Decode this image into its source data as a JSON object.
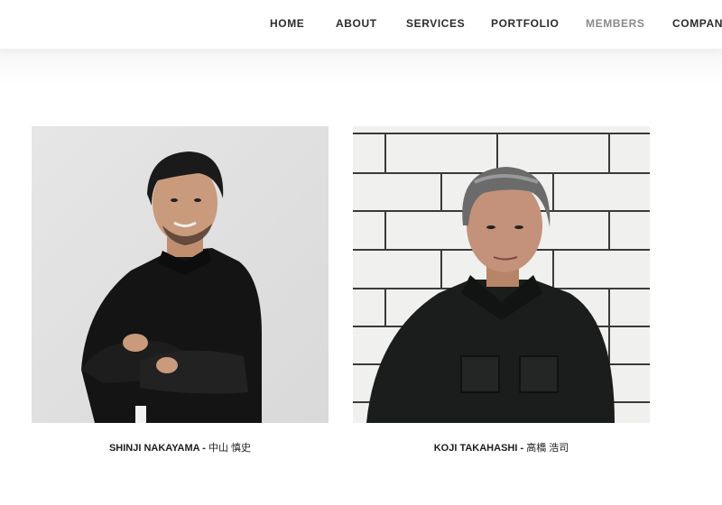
{
  "nav": {
    "items": [
      {
        "label": "HOME",
        "active": false
      },
      {
        "label": "ABOUT",
        "active": false
      },
      {
        "label": "SERVICES",
        "active": false
      },
      {
        "label": "PORTFOLIO",
        "active": false
      },
      {
        "label": "MEMBERS",
        "active": true
      },
      {
        "label": "COMPANY",
        "active": false
      }
    ],
    "colors": {
      "default": "#2b2b2b",
      "active": "#8a8a8a"
    }
  },
  "members": [
    {
      "name": "SHINJI NAKAYAMA",
      "separator": " - ",
      "name_jp": "中山 慎史",
      "photo": "portrait-photo"
    },
    {
      "name": "KOJI TAKAHASHI",
      "separator": " - ",
      "name_jp": "高橋 浩司",
      "photo": "portrait-photo"
    }
  ]
}
